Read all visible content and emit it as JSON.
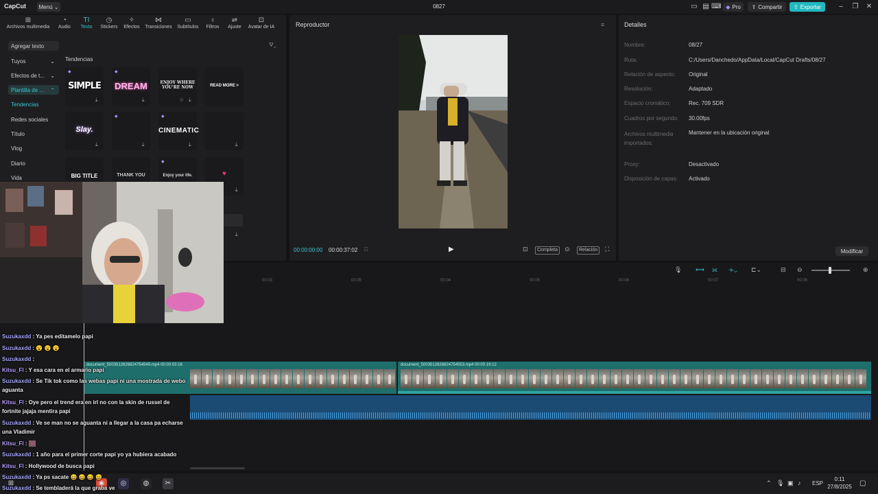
{
  "titlebar": {
    "app_name": "CapCut",
    "menu_label": "Menú",
    "project_title": "0827",
    "pro_label": "Pro",
    "share_label": "Compartir",
    "export_label": "Exportar"
  },
  "toolbar": {
    "tools": [
      {
        "label": "Archivos multimedia",
        "icon": "media-icon"
      },
      {
        "label": "Audio",
        "icon": "audio-icon"
      },
      {
        "label": "Texto",
        "icon": "text-icon"
      },
      {
        "label": "Stickers",
        "icon": "sticker-icon"
      },
      {
        "label": "Efectos",
        "icon": "effects-icon"
      },
      {
        "label": "Transiciones",
        "icon": "transitions-icon"
      },
      {
        "label": "Subtítulos",
        "icon": "subtitles-icon"
      },
      {
        "label": "Filtros",
        "icon": "filters-icon"
      },
      {
        "label": "Ajuste",
        "icon": "adjust-icon"
      },
      {
        "label": "Avatar de IA",
        "icon": "ai-avatar-icon"
      }
    ]
  },
  "sidebar": {
    "add_text": "Agregar texto",
    "yours": "Tuyos",
    "text_effects": "Efectos de t...",
    "text_templates": "Plantilla de ...",
    "categories": [
      "Tendencias",
      "Redes sociales",
      "Título",
      "Vlog",
      "Diario",
      "Vida"
    ]
  },
  "templates": {
    "section_title": "Tendencias",
    "cards": [
      "SIMPLE",
      "DREAM",
      "ENJOY WHERE YOU'RE NOW",
      "READ MORE >",
      "Slay.",
      "",
      "CINEMATIC",
      "",
      "BIG TITLE",
      "THANK YOU",
      "Enjoy your life.",
      ""
    ]
  },
  "player": {
    "title": "Reproductor",
    "time_current": "00:00:00:00",
    "time_total": "00:00:37:02",
    "complete_label": "Completa",
    "ratio_label": "Relación"
  },
  "details": {
    "title": "Detalles",
    "fields": [
      {
        "label": "Nombre:",
        "value": "08/27"
      },
      {
        "label": "Ruta:",
        "value": "C:/Users/Danchedo/AppData/Local/CapCut Drafts/08/27"
      },
      {
        "label": "Relación de aspecto:",
        "value": "Original"
      },
      {
        "label": "Resolución:",
        "value": "Adaptado"
      },
      {
        "label": "Espacio cromático:",
        "value": "Rec. 709 SDR"
      },
      {
        "label": "Cuadros por segundo:",
        "value": "30.00fps"
      },
      {
        "label": "Archivos multimedia importados:",
        "value": "Mantener en la ubicación original"
      },
      {
        "label": "Proxy:",
        "value": "Desactivado"
      },
      {
        "label": "Disposición de capas:",
        "value": "Activado"
      }
    ],
    "modify_label": "Modificar"
  },
  "timeline": {
    "ruler": [
      "00:03",
      "00:05",
      "00:04",
      "00:05",
      "00:06",
      "00:07",
      "00:08"
    ],
    "clip1_label": "document_5003512826824754549.mp4   00:00:03:16",
    "clip2_label": "document_5003512826824754553.mp4   00:00:19:12"
  },
  "chat": [
    {
      "user": "Suzukaxdd",
      "text": "Ya pes editamelo papi"
    },
    {
      "user": "Suzukaxdd",
      "text": "😮 😮 😮"
    },
    {
      "user": "Suzukaxdd",
      "text": ""
    },
    {
      "user": "Kitsu_Fl",
      "text": "Y esa cara en el armario papi"
    },
    {
      "user": "Suzukaxdd",
      "text": "Se Tik tok como las webas papi ni una mostrada de webo aguanta"
    },
    {
      "user": "Kitsu_Fl",
      "text": "Oye pero el trend era en irl no con la skin de russel de fortnite jajaja mentira papi"
    },
    {
      "user": "Suzukaxdd",
      "text": "Ve se man no se aguanta ni a llegar a la casa pa echarse una Vladimir"
    },
    {
      "user": "Kitsu_Fl",
      "text": ""
    },
    {
      "user": "Suzukaxdd",
      "text": "1 año para el primer corte papi yo ya hubiera acabado"
    },
    {
      "user": "Kitsu_Fl",
      "text": "Hollywood de busca papi"
    },
    {
      "user": "Suzukaxdd",
      "text": "Ya ps sacate 😄 😄 😄 😄"
    },
    {
      "user": "Suzukaxdd",
      "text": "Se tembladerá la que graba ve"
    }
  ],
  "taskbar": {
    "lang": "ESP",
    "time": "0:11",
    "date": "27/8/2025"
  },
  "colors": {
    "accent": "#22b8c0",
    "panel": "#1e1e20",
    "clip": "#1e6f6b",
    "audio": "#1b4a73"
  }
}
